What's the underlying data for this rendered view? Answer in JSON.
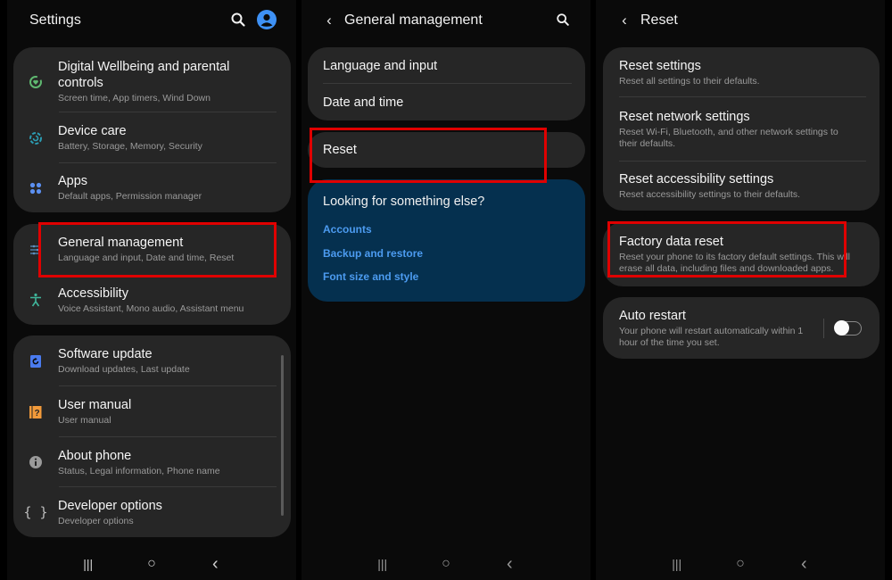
{
  "screen1": {
    "title": "Settings",
    "icons": {
      "search": "search-icon",
      "profile": "profile-icon"
    },
    "groups": [
      {
        "items": [
          {
            "icon": "digital-wellbeing-icon",
            "color": "#5fb870",
            "title": "Digital Wellbeing and parental controls",
            "subtitle": "Screen time, App timers, Wind Down"
          },
          {
            "icon": "device-care-icon",
            "color": "#2c9db3",
            "title": "Device care",
            "subtitle": "Battery, Storage, Memory, Security"
          },
          {
            "icon": "apps-icon",
            "color": "#5b8ff0",
            "title": "Apps",
            "subtitle": "Default apps, Permission manager"
          }
        ]
      },
      {
        "items": [
          {
            "icon": "general-management-icon",
            "color": "#5b8fbf",
            "title": "General management",
            "subtitle": "Language and input, Date and time, Reset"
          },
          {
            "icon": "accessibility-icon",
            "color": "#3fb59a",
            "title": "Accessibility",
            "subtitle": "Voice Assistant, Mono audio, Assistant menu"
          }
        ]
      },
      {
        "items": [
          {
            "icon": "software-update-icon",
            "color": "#4a7bef",
            "title": "Software update",
            "subtitle": "Download updates, Last update"
          },
          {
            "icon": "user-manual-icon",
            "color": "#f29a3a",
            "title": "User manual",
            "subtitle": "User manual"
          },
          {
            "icon": "about-phone-icon",
            "color": "#9a9a9a",
            "title": "About phone",
            "subtitle": "Status, Legal information, Phone name"
          },
          {
            "icon": "developer-options-icon",
            "color": "#bdbdbd",
            "title": "Developer options",
            "subtitle": "Developer options"
          }
        ]
      }
    ]
  },
  "screen2": {
    "title": "General management",
    "group1": [
      "Language and input",
      "Date and time"
    ],
    "reset_label": "Reset",
    "suggest": {
      "heading": "Looking for something else?",
      "links": [
        "Accounts",
        "Backup and restore",
        "Font size and style"
      ]
    }
  },
  "screen3": {
    "title": "Reset",
    "group1": [
      {
        "title": "Reset settings",
        "subtitle": "Reset all settings to their defaults."
      },
      {
        "title": "Reset network settings",
        "subtitle": "Reset Wi-Fi, Bluetooth, and other network settings to their defaults."
      },
      {
        "title": "Reset accessibility settings",
        "subtitle": "Reset accessibility settings to their defaults."
      }
    ],
    "factory": {
      "title": "Factory data reset",
      "subtitle": "Reset your phone to its factory default settings. This will erase all data, including files and downloaded apps."
    },
    "auto_restart": {
      "title": "Auto restart",
      "subtitle": "Your phone will restart automatically within 1 hour of the time you set.",
      "enabled": false
    }
  },
  "navbar": {
    "recents": "|||",
    "home": "○",
    "back": "‹"
  },
  "colors": {
    "highlight": "#e00000",
    "link": "#4c9bf0",
    "accent": "#3e91f5"
  }
}
